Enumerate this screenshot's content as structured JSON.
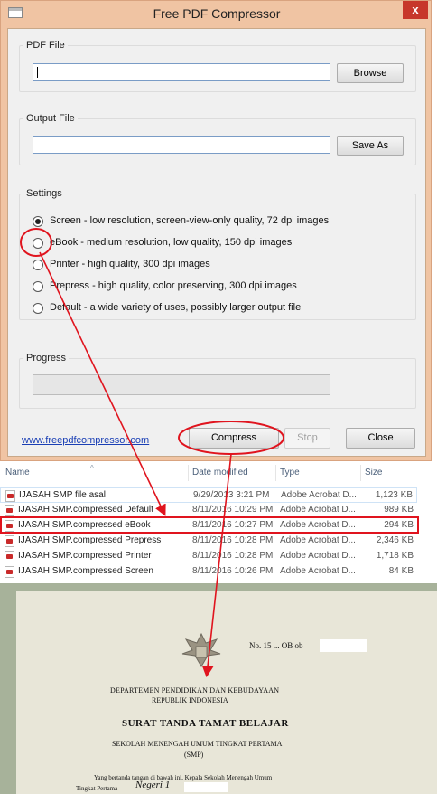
{
  "window": {
    "title": "Free PDF Compressor",
    "close_glyph": "x"
  },
  "pdf_file": {
    "label": "PDF File",
    "value": "",
    "browse_label": "Browse"
  },
  "output_file": {
    "label": "Output File",
    "value": "",
    "save_as_label": "Save As"
  },
  "settings": {
    "label": "Settings",
    "options": [
      {
        "label": "Screen - low resolution, screen-view-only quality, 72 dpi images",
        "selected": true
      },
      {
        "label": "eBook - medium resolution, low quality, 150 dpi images",
        "selected": false
      },
      {
        "label": "Printer - high quality, 300 dpi images",
        "selected": false
      },
      {
        "label": "Prepress - high quality, color preserving, 300 dpi images",
        "selected": false
      },
      {
        "label": "Default - a wide variety of uses, possibly larger output file",
        "selected": false
      }
    ]
  },
  "progress": {
    "label": "Progress",
    "value": 0
  },
  "footer": {
    "link": "www.freepdfcompressor.com",
    "compress_label": "Compress",
    "stop_label": "Stop",
    "close_label": "Close"
  },
  "explorer": {
    "columns": [
      "Name",
      "Date modified",
      "Type",
      "Size"
    ],
    "files": [
      {
        "name": "IJASAH SMP file asal",
        "date": "9/29/2013 3:21 PM",
        "type": "Adobe Acrobat D...",
        "size": "1,123 KB"
      },
      {
        "name": "IJASAH SMP.compressed Default",
        "date": "8/11/2016 10:29 PM",
        "type": "Adobe Acrobat D...",
        "size": "989 KB"
      },
      {
        "name": "IJASAH SMP.compressed eBook",
        "date": "8/11/2016 10:27 PM",
        "type": "Adobe Acrobat D...",
        "size": "294 KB"
      },
      {
        "name": "IJASAH SMP.compressed Prepress",
        "date": "8/11/2016 10:28 PM",
        "type": "Adobe Acrobat D...",
        "size": "2,346 KB"
      },
      {
        "name": "IJASAH SMP.compressed Printer",
        "date": "8/11/2016 10:28 PM",
        "type": "Adobe Acrobat D...",
        "size": "1,718 KB"
      },
      {
        "name": "IJASAH SMP.compressed Screen",
        "date": "8/11/2016 10:26 PM",
        "type": "Adobe Acrobat D...",
        "size": "84 KB"
      }
    ]
  },
  "document": {
    "number_label": "No. 15 ... OB ob",
    "ministry": "DEPARTEMEN PENDIDIKAN DAN KEBUDAYAAN",
    "republic": "REPUBLIK INDONESIA",
    "title": "SURAT TANDA TAMAT BELAJAR",
    "school_type": "SEKOLAH MENENGAH UMUM TINGKAT PERTAMA",
    "abbr": "(SMP)",
    "body_line1": "Yang bertanda tangan di bawah ini, Kepala Sekolah Menengah Umum",
    "body_line2": "Tingkat Pertama",
    "handwritten": "Negeri 1"
  },
  "colors": {
    "annotation_red": "#e0141e",
    "window_frame": "#f0c4a3",
    "close_button": "#c7372a",
    "link": "#1a3fb5"
  }
}
